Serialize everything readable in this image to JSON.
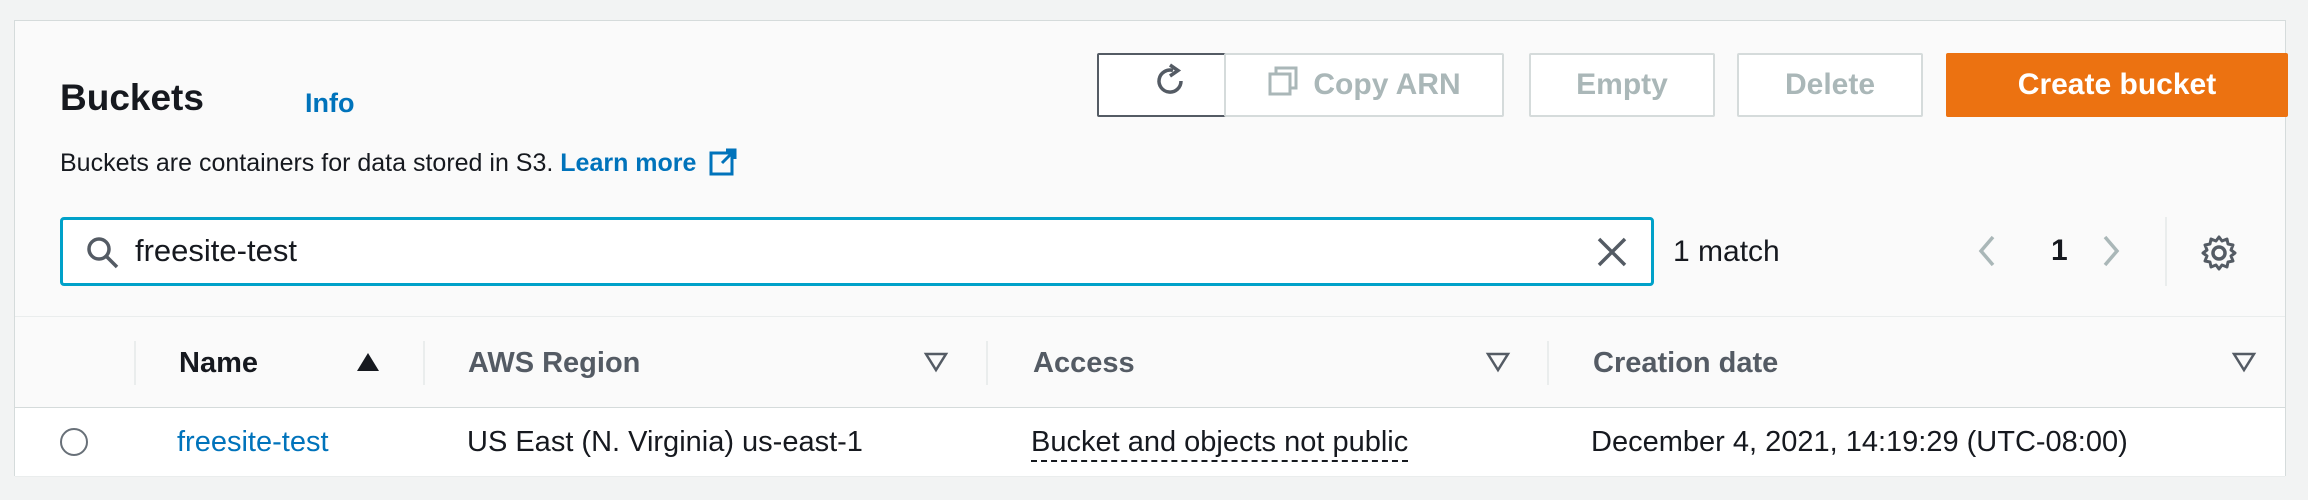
{
  "header": {
    "title": "Buckets",
    "info_label": "Info",
    "description": "Buckets are containers for data stored in S3.",
    "learn_more": "Learn more"
  },
  "toolbar": {
    "copy_arn_label": "Copy ARN",
    "empty_label": "Empty",
    "delete_label": "Delete",
    "create_label": "Create bucket"
  },
  "search": {
    "value": "freesite-test",
    "match_text": "1 match"
  },
  "pagination": {
    "current_page": "1"
  },
  "table": {
    "columns": [
      "Name",
      "AWS Region",
      "Access",
      "Creation date"
    ],
    "rows": [
      {
        "name": "freesite-test",
        "region": "US East (N. Virginia) us-east-1",
        "access": "Bucket and objects not public",
        "created": "December 4, 2021, 14:19:29 (UTC-08:00)"
      }
    ]
  },
  "colors": {
    "accent": "#ec7211",
    "link": "#0073bb",
    "focus": "#00a1c9"
  }
}
